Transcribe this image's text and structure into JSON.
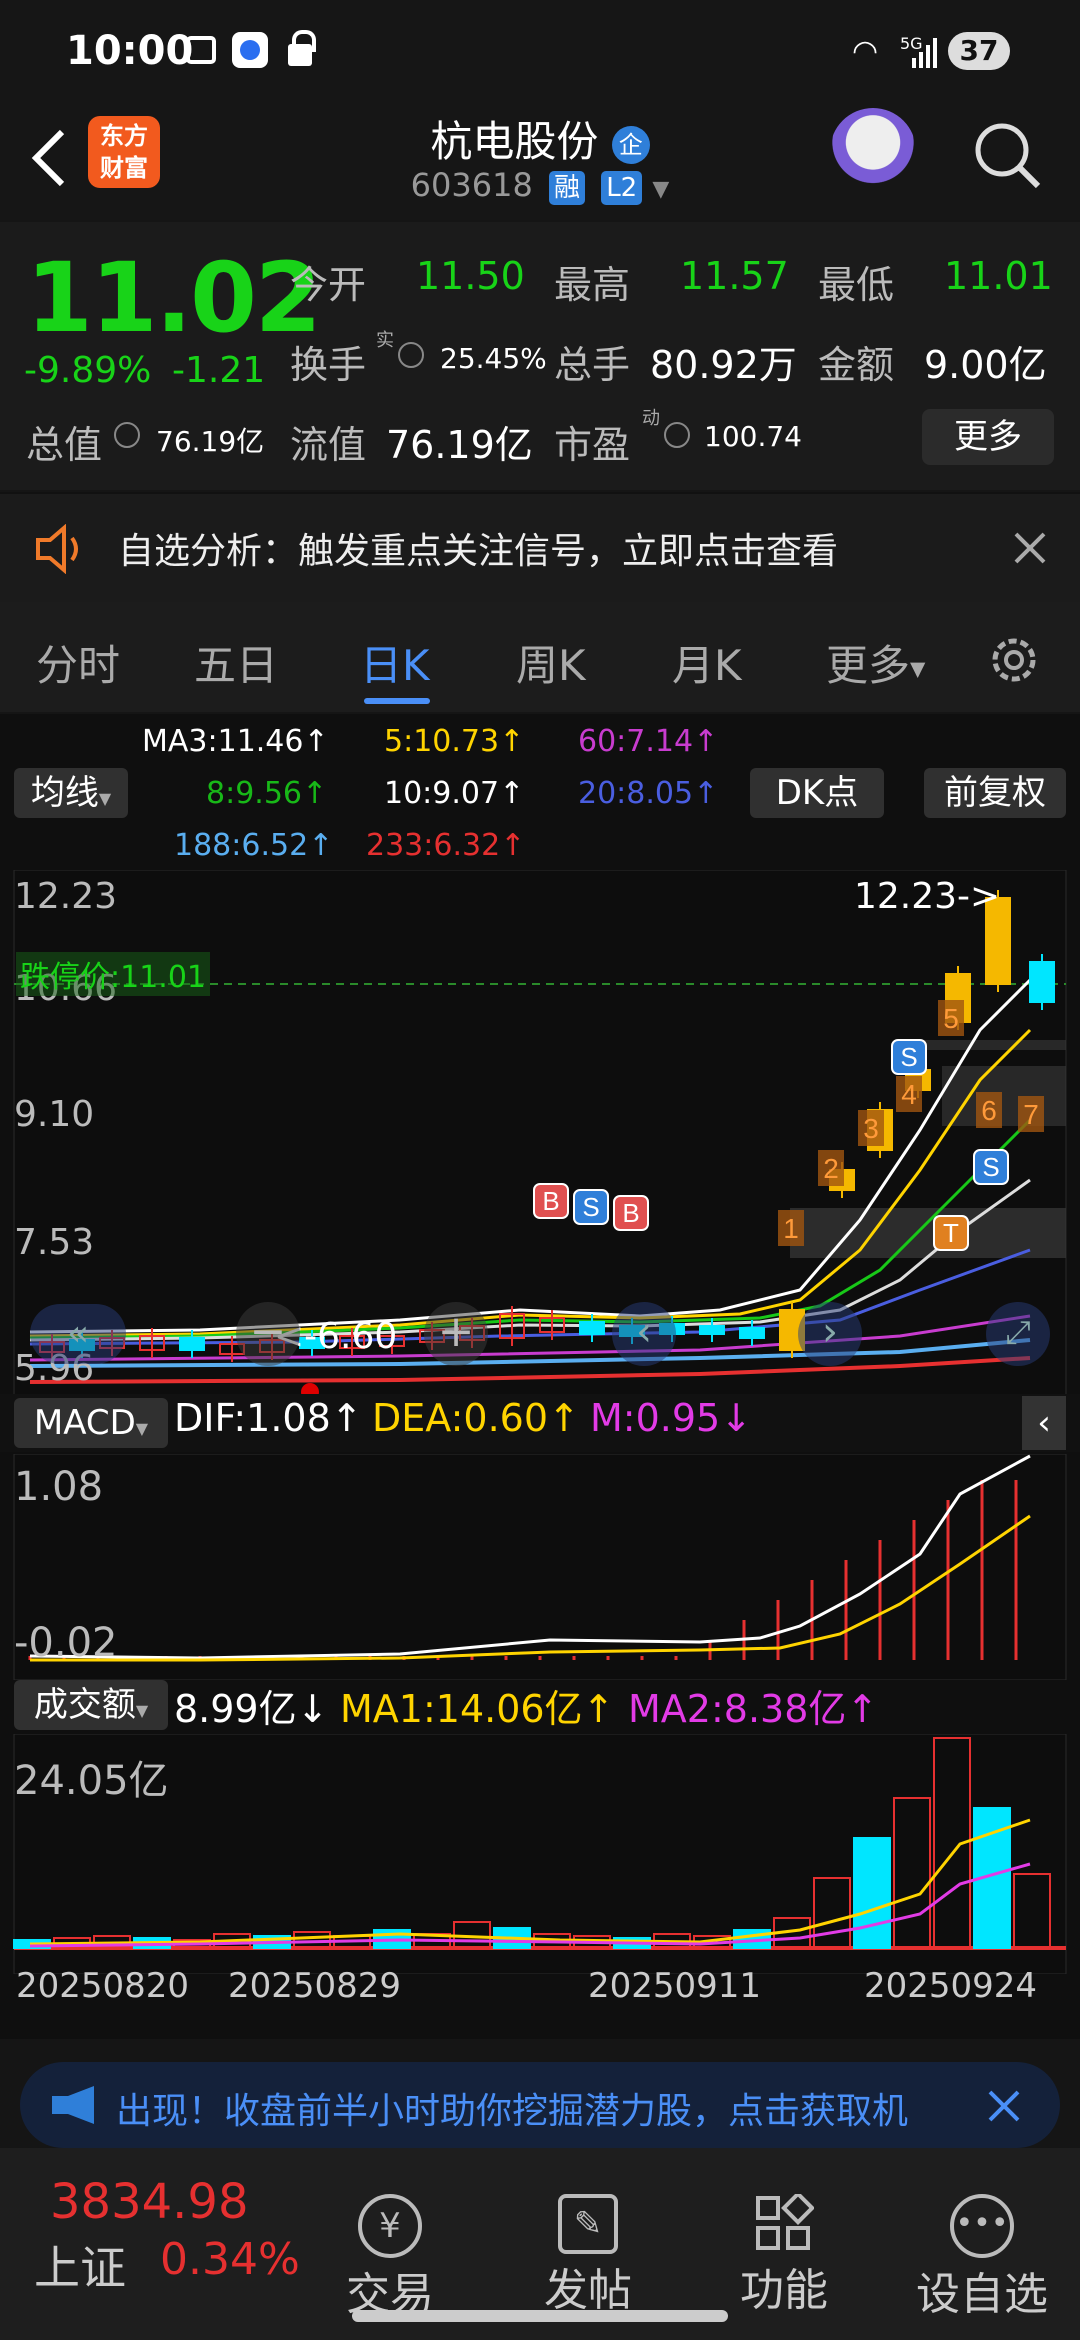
{
  "status": {
    "time": "10:00",
    "network": "5G",
    "battery": "37"
  },
  "header": {
    "logo": [
      "东方",
      "财富"
    ],
    "stock_name": "杭电股份",
    "badge": "企",
    "code": "603618",
    "tags": [
      "融",
      "L2"
    ]
  },
  "quote": {
    "price": "11.02",
    "pct": "-9.89%",
    "change": "-1.21",
    "open_label": "今开",
    "open": "11.50",
    "high_label": "最高",
    "high": "11.57",
    "low_label": "最低",
    "low": "11.01",
    "turnover_label": "换手",
    "turnover_sup": "实",
    "turnover": "25.45%",
    "volume_label": "总手",
    "volume": "80.92万",
    "amount_label": "金额",
    "amount": "9.00亿",
    "mcap_label": "总值",
    "mcap": "76.19亿",
    "float_label": "流值",
    "float": "76.19亿",
    "pe_label": "市盈",
    "pe_sup": "动",
    "pe": "100.74",
    "more": "更多"
  },
  "notice": {
    "text": "自选分析：触发重点关注信号，立即点击查看"
  },
  "tabs": [
    "分时",
    "五日",
    "日K",
    "周K",
    "月K",
    "更多"
  ],
  "ma_legend": {
    "ma3": "MA3:11.46↑",
    "ma5": "5:10.73↑",
    "ma60": "60:7.14↑",
    "ma8": "8:9.56↑",
    "ma10": "10:9.07↑",
    "ma20": "20:8.05↑",
    "ma188": "188:6.52↑",
    "ma233": "233:6.32↑",
    "select": "均线",
    "dk": "DK点",
    "adjust": "前复权"
  },
  "colors": {
    "green": "#18d318",
    "red": "#e63030",
    "yellow": "#ffd400",
    "magenta": "#e23be6",
    "blue": "#4a8ff7",
    "cyan": "#00e6ff",
    "accent": "#4a8ff7"
  },
  "kchart": {
    "y_labels": [
      "12.23",
      "10.66",
      "9.10",
      "7.53",
      "5.96"
    ],
    "limit_label": "跌停价:11.01",
    "max_label": "12.23->",
    "min_label": "<-6.60",
    "markers": [
      "B",
      "S",
      "B",
      "S",
      "S",
      "T"
    ],
    "numbers": [
      "1",
      "2",
      "3",
      "4",
      "5",
      "6",
      "7"
    ]
  },
  "macd": {
    "select": "MACD",
    "dif": "DIF:1.08↑",
    "dea": "DEA:0.60↑",
    "m": "M:0.95↓",
    "y_top": "1.08",
    "y_bottom": "-0.02"
  },
  "volume": {
    "select": "成交额",
    "value": "8.99亿↓",
    "ma1": "MA1:14.06亿↑",
    "ma2": "MA2:8.38亿↑",
    "y_top": "24.05亿"
  },
  "dates": [
    "20250820",
    "20250829",
    "20250911",
    "20250924"
  ],
  "ad": {
    "text": "出现！收盘前半小时助你挖掘潜力股，点击获取机"
  },
  "bottom": {
    "index_value": "3834.98",
    "index_name": "上证",
    "index_pct": "0.34%",
    "items": [
      "交易",
      "发帖",
      "功能",
      "设自选"
    ]
  }
}
